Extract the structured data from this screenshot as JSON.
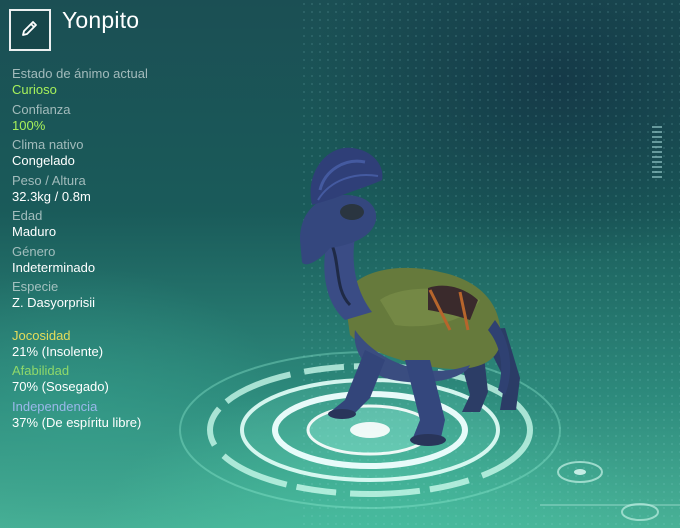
{
  "creature": {
    "name": "Yonpito",
    "edit_icon": "pencil-icon"
  },
  "stats": [
    {
      "label": "Estado de ánimo actual",
      "value": "Curioso",
      "value_color": "#a6f05a"
    },
    {
      "label": "Confianza",
      "value": "100%",
      "value_color": "#a6f05a"
    },
    {
      "label": "Clima nativo",
      "value": "Congelado"
    },
    {
      "label": "Peso / Altura",
      "value": "32.3kg / 0.8m"
    },
    {
      "label": "Edad",
      "value": "Maduro"
    },
    {
      "label": "Género",
      "value": "Indeterminado"
    },
    {
      "label": "Especie",
      "value": "Z. Dasyorprisii"
    }
  ],
  "traits": [
    {
      "label": "Jocosidad",
      "value": "21% (Insolente)",
      "label_color": "#e5dc5a"
    },
    {
      "label": "Afabilidad",
      "value": "70% (Sosegado)",
      "label_color": "#8fd86a"
    },
    {
      "label": "Independencia",
      "value": "37% (De espíritu libre)",
      "label_color": "#9ab8ea"
    }
  ]
}
